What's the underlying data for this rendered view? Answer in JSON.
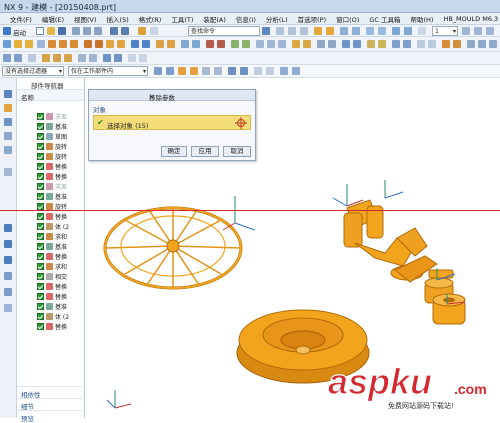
{
  "window": {
    "title": "NX 9 - 建模 - [20150408.prt]"
  },
  "menu": {
    "items": [
      "文件(F)",
      "编辑(E)",
      "视图(V)",
      "插入(S)",
      "格式(R)",
      "工具(T)",
      "装配(A)",
      "信息(I)",
      "分析(L)",
      "首选项(P)",
      "窗口(O)",
      "GC 工具箱",
      "帮助(H)",
      "HB_MOULD M6.3"
    ]
  },
  "toolbar": {
    "start_label": "启动",
    "command_search_placeholder": "查找命令",
    "layer_value": "1",
    "filter_value": "没有选择过滤器",
    "scope_value": "仅在工作部件内"
  },
  "navigator": {
    "title": "部件导航器",
    "column_name": "名称",
    "rows": [
      {
        "label": "求差",
        "dim": true,
        "color": "#c9a"
      },
      {
        "label": "基准",
        "dim": false,
        "color": "#7a9"
      },
      {
        "label": "草图",
        "dim": false,
        "color": "#8ab"
      },
      {
        "label": "旋转",
        "dim": false,
        "color": "#c84"
      },
      {
        "label": "旋转",
        "dim": false,
        "color": "#c84"
      },
      {
        "label": "替换",
        "dim": false,
        "color": "#d66"
      },
      {
        "label": "替换",
        "dim": false,
        "color": "#d66"
      },
      {
        "label": "求差",
        "dim": true,
        "color": "#c9a"
      },
      {
        "label": "基准",
        "dim": false,
        "color": "#7a9"
      },
      {
        "label": "旋转",
        "dim": false,
        "color": "#c84"
      },
      {
        "label": "替换",
        "dim": false,
        "color": "#d66"
      },
      {
        "label": "体 (2",
        "dim": false,
        "color": "#b96"
      },
      {
        "label": "求和",
        "dim": false,
        "color": "#c84"
      },
      {
        "label": "基准",
        "dim": false,
        "color": "#7a9"
      },
      {
        "label": "替换",
        "dim": false,
        "color": "#d66"
      },
      {
        "label": "求和",
        "dim": false,
        "color": "#c84"
      },
      {
        "label": "相交",
        "dim": false,
        "color": "#aaa"
      },
      {
        "label": "替换",
        "dim": false,
        "color": "#d66"
      },
      {
        "label": "替换",
        "dim": false,
        "color": "#d66"
      },
      {
        "label": "基准",
        "dim": false,
        "color": "#7a9"
      },
      {
        "label": "体 (2",
        "dim": false,
        "color": "#b96"
      },
      {
        "label": "替换",
        "dim": false,
        "color": "#d66"
      }
    ],
    "bottom_tabs": [
      "相依性",
      "细节",
      "预览"
    ]
  },
  "dialog": {
    "title": "移除参数",
    "section": "对象",
    "selection_label": "选择对象 (15)",
    "ok_label": "确定",
    "apply_label": "应用",
    "cancel_label": "取消"
  },
  "watermark": {
    "brand": "aspku",
    "suffix": ".com",
    "tagline": "免费网站源码下载站!"
  },
  "colors": {
    "part_orange": "#f2a41d",
    "part_dark": "#b36a07",
    "accent_red": "#d4292e",
    "dialog_highlight": "#f4dc79"
  }
}
